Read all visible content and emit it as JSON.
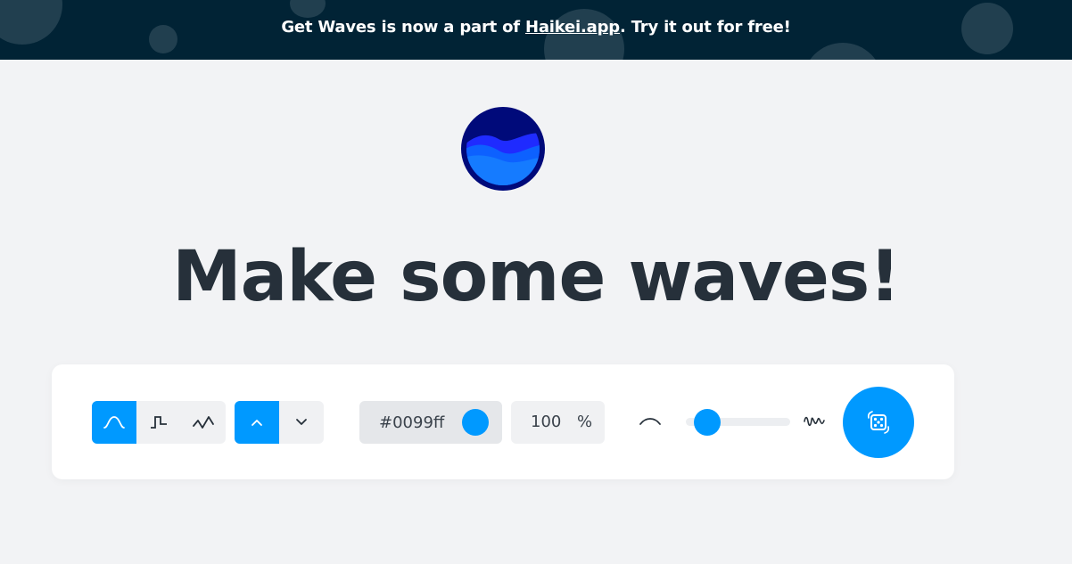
{
  "banner": {
    "text_before": "Get Waves is now a part of ",
    "link_text": "Haikei.app",
    "text_after": ". Try it out for free!",
    "background": "#012335"
  },
  "hero": {
    "title": "Make some waves!"
  },
  "toolbar": {
    "wave_types": [
      {
        "icon": "smooth-wave-icon",
        "active": true
      },
      {
        "icon": "step-wave-icon",
        "active": false
      },
      {
        "icon": "peak-wave-icon",
        "active": false
      }
    ],
    "directions": [
      {
        "icon": "chevron-up-icon",
        "active": true
      },
      {
        "icon": "chevron-down-icon",
        "active": false
      }
    ],
    "color_hex": "#0099ff",
    "opacity_value": "100",
    "opacity_unit": "%",
    "complexity_level": 0.1,
    "randomize_icon": "dice-icon"
  },
  "colors": {
    "accent": "#0099ff",
    "title": "#26303a",
    "page_bg": "#f2f3f5"
  }
}
